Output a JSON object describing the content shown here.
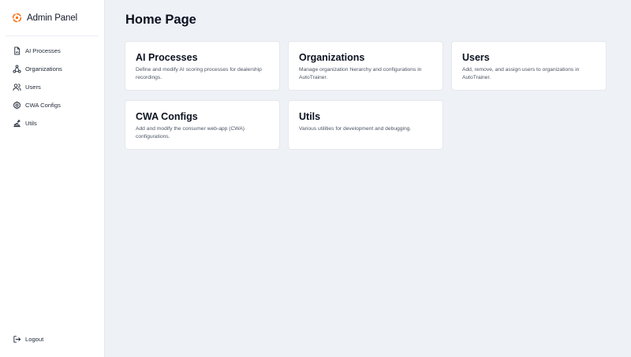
{
  "app": {
    "title": "Admin Panel",
    "accent": "#f97316"
  },
  "sidebar": {
    "items": [
      {
        "label": "AI Processes",
        "icon": "document-chart-icon"
      },
      {
        "label": "Organizations",
        "icon": "hierarchy-icon"
      },
      {
        "label": "Users",
        "icon": "users-icon"
      },
      {
        "label": "CWA Configs",
        "icon": "gear-icon"
      },
      {
        "label": "Utils",
        "icon": "tools-icon"
      }
    ],
    "logout_label": "Logout"
  },
  "main": {
    "title": "Home Page",
    "cards": [
      {
        "title": "AI Processes",
        "description": "Define and modify AI scoring processes for dealership recordings."
      },
      {
        "title": "Organizations",
        "description": "Manage organization hierarchy and configurations in AutoTrainer."
      },
      {
        "title": "Users",
        "description": "Add, remove, and assign users to organizations in AutoTrainer."
      },
      {
        "title": "CWA Configs",
        "description": "Add and modify the consumer web-app (CWA) configurations."
      },
      {
        "title": "Utils",
        "description": "Various utilities for development and debugging."
      }
    ]
  }
}
